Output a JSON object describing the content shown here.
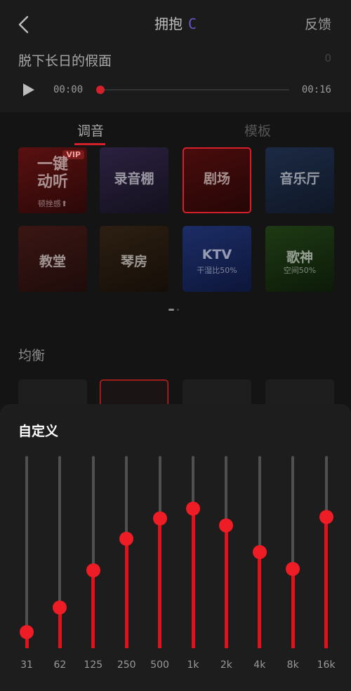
{
  "header": {
    "title": "拥抱",
    "title_accent": "C",
    "feedback_label": "反馈",
    "song_name": "脱下长日的假面",
    "song_counter": "0",
    "player": {
      "current_time": "00:00",
      "total_time": "00:16",
      "progress_fraction": 0.0
    }
  },
  "tabs": [
    {
      "label": "调音",
      "active": true
    },
    {
      "label": "模板",
      "active": false
    }
  ],
  "sound_effects": [
    {
      "label": "一键动听",
      "sub": "顿挫感⬆",
      "badge": "VIP",
      "selected": false
    },
    {
      "label": "录音棚",
      "sub": "",
      "badge": "",
      "selected": false
    },
    {
      "label": "剧场",
      "sub": "",
      "badge": "",
      "selected": true
    },
    {
      "label": "音乐厅",
      "sub": "",
      "badge": "",
      "selected": false
    },
    {
      "label": "教堂",
      "sub": "",
      "badge": "",
      "selected": false
    },
    {
      "label": "琴房",
      "sub": "",
      "badge": "",
      "selected": false
    },
    {
      "label": "KTV",
      "sub": "干湿比50%",
      "badge": "",
      "selected": false
    },
    {
      "label": "歌神",
      "sub": "空间50%",
      "badge": "",
      "selected": false
    }
  ],
  "pager": {
    "pages": 2,
    "current": 1
  },
  "equalizer": {
    "label": "均衡",
    "selected_preset": 2,
    "sheet_title": "自定义",
    "bands": [
      {
        "label": "31",
        "level": 0.02
      },
      {
        "label": "62",
        "level": 0.17
      },
      {
        "label": "125",
        "level": 0.39
      },
      {
        "label": "250",
        "level": 0.58
      },
      {
        "label": "500",
        "level": 0.7
      },
      {
        "label": "1k",
        "level": 0.76
      },
      {
        "label": "2k",
        "level": 0.66
      },
      {
        "label": "4k",
        "level": 0.5
      },
      {
        "label": "8k",
        "level": 0.4
      },
      {
        "label": "16k",
        "level": 0.71
      }
    ]
  },
  "colors": {
    "accent": "#e0121c",
    "background": "#141414",
    "sheet": "#1d1d1d"
  }
}
